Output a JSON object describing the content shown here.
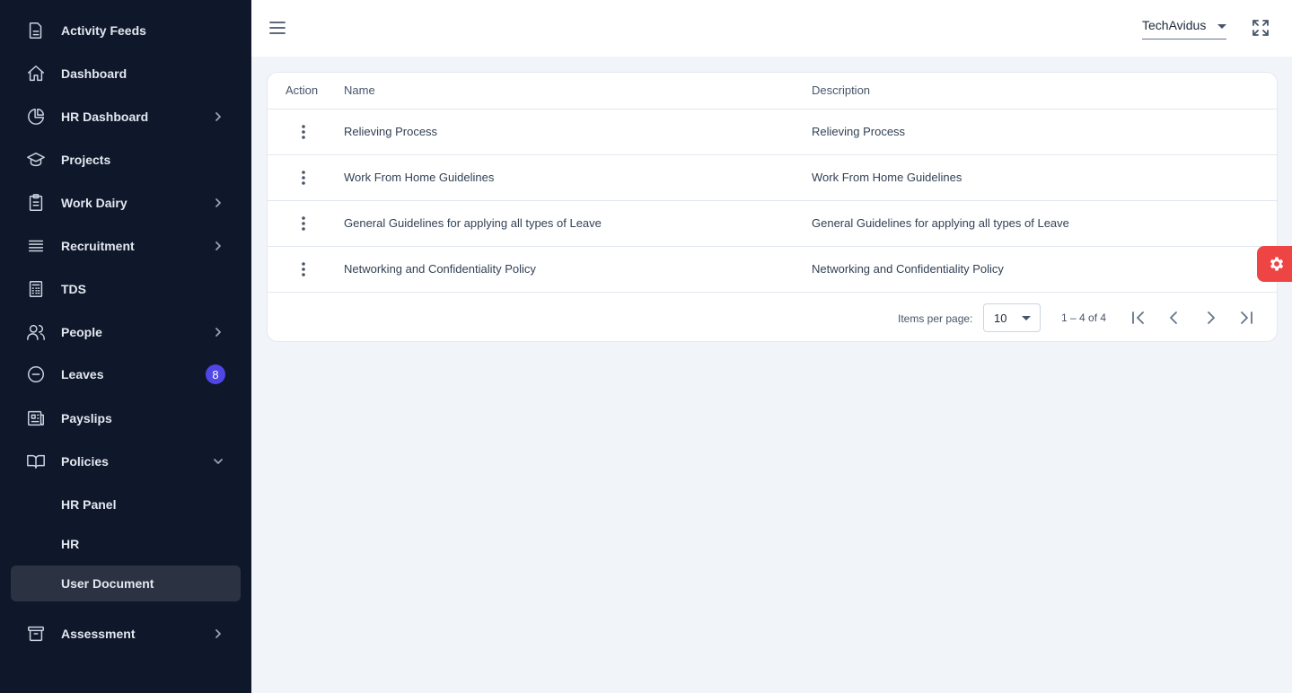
{
  "sidebar": {
    "items": [
      {
        "label": "Activity Feeds",
        "icon": "document-icon"
      },
      {
        "label": "Dashboard",
        "icon": "home-icon"
      },
      {
        "label": "HR Dashboard",
        "icon": "pie-chart-icon"
      },
      {
        "label": "Projects",
        "icon": "graduation-cap-icon"
      },
      {
        "label": "Work Dairy",
        "icon": "clipboard-icon"
      },
      {
        "label": "Recruitment",
        "icon": "list-icon"
      },
      {
        "label": "TDS",
        "icon": "calculator-icon"
      },
      {
        "label": "People",
        "icon": "users-icon"
      },
      {
        "label": "Leaves",
        "icon": "minus-circle-icon",
        "badge": "8"
      },
      {
        "label": "Payslips",
        "icon": "newspaper-icon"
      },
      {
        "label": "Policies",
        "icon": "book-icon"
      },
      {
        "label": "Assessment",
        "icon": "archive-icon"
      }
    ],
    "policies_sub": [
      {
        "label": "HR Panel"
      },
      {
        "label": "HR"
      },
      {
        "label": "User Document"
      }
    ],
    "accent": "#4f46e5"
  },
  "topbar": {
    "org_selected": "TechAvidus"
  },
  "table": {
    "headers": {
      "action": "Action",
      "name": "Name",
      "description": "Description"
    },
    "rows": [
      {
        "name": "Relieving Process",
        "description": "Relieving Process"
      },
      {
        "name": "Work From Home Guidelines",
        "description": "Work From Home Guidelines"
      },
      {
        "name": "General Guidelines for applying all types of Leave",
        "description": "General Guidelines for applying all types of Leave"
      },
      {
        "name": "Networking and Confidentiality Policy",
        "description": "Networking and Confidentiality Policy"
      }
    ]
  },
  "paginator": {
    "items_per_page_label": "Items per page:",
    "items_per_page": "10",
    "range": "1 – 4 of 4"
  },
  "settings_fab_color": "#ef4444"
}
